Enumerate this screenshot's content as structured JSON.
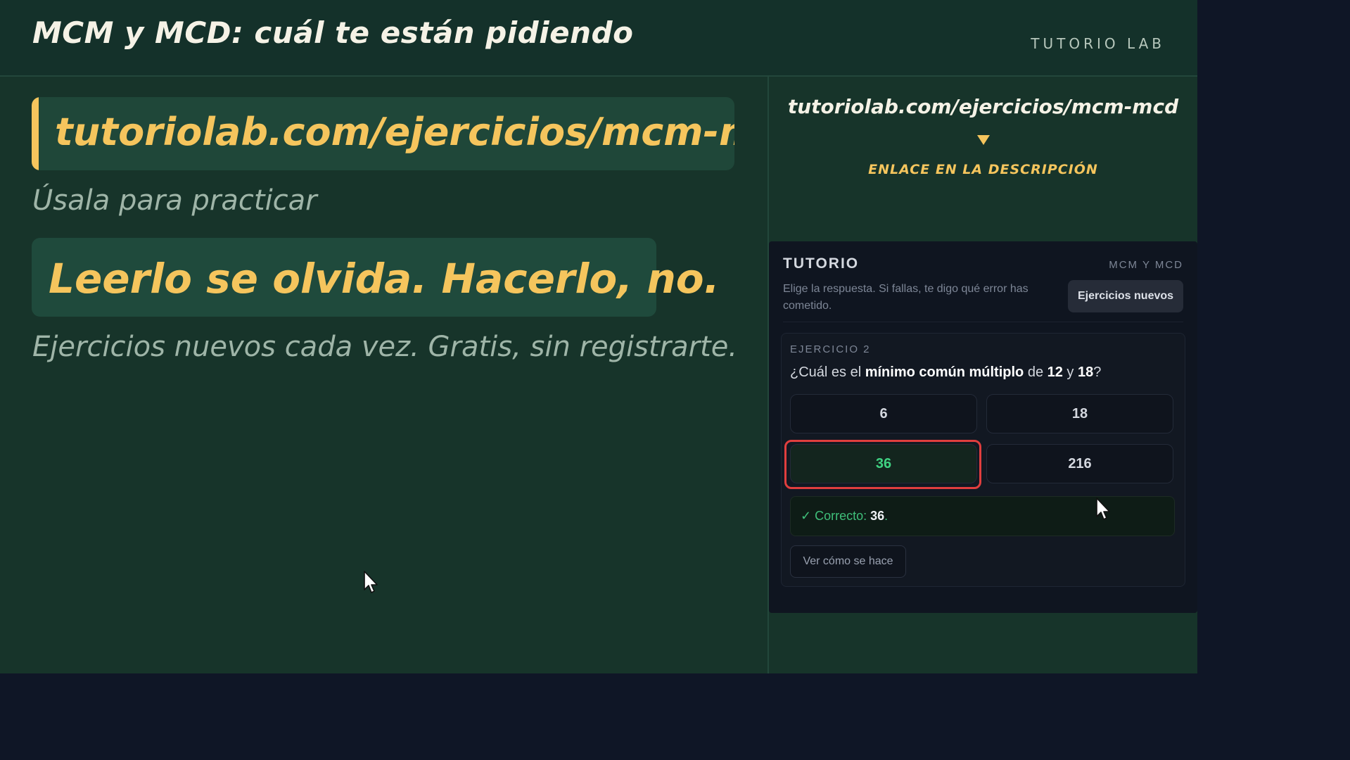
{
  "header": {
    "title": "MCM y MCD: cuál te están pidiendo",
    "brand": "TUTORIO LAB"
  },
  "left": {
    "url": "tutoriolab.com/ejercicios/mcm-mcd",
    "practice": "Úsala para practicar",
    "motto": "Leerlo se olvida. Hacerlo, no.",
    "subtitle": "Ejercicios nuevos cada vez. Gratis, sin registrarte."
  },
  "right": {
    "url": "tutoriolab.com/ejercicios/mcm-mcd",
    "arrow_icon": "arrow-down-icon",
    "link_note": "ENLACE EN LA DESCRIPCIÓN"
  },
  "widget": {
    "title": "TUTORIO",
    "tag": "MCM Y MCD",
    "description": "Elige la respuesta. Si fallas, te digo qué error has cometido.",
    "new_button": "Ejercicios nuevos",
    "exercise": {
      "label": "EJERCICIO 2",
      "question_prefix": "¿Cuál es el ",
      "question_bold": "mínimo común múltiplo",
      "question_mid": " de ",
      "question_a": "12",
      "question_y": " y ",
      "question_b": "18",
      "question_end": "?",
      "options": [
        "6",
        "18",
        "36",
        "216"
      ],
      "selected": "36",
      "feedback_prefix": "✓ Correcto: ",
      "feedback_value": "36",
      "feedback_end": ".",
      "howto_button": "Ver cómo se hace"
    }
  },
  "colors": {
    "board": "#17342a",
    "accent": "#f5c55d",
    "correct": "#3fd282",
    "highlight": "#e03e3e"
  }
}
